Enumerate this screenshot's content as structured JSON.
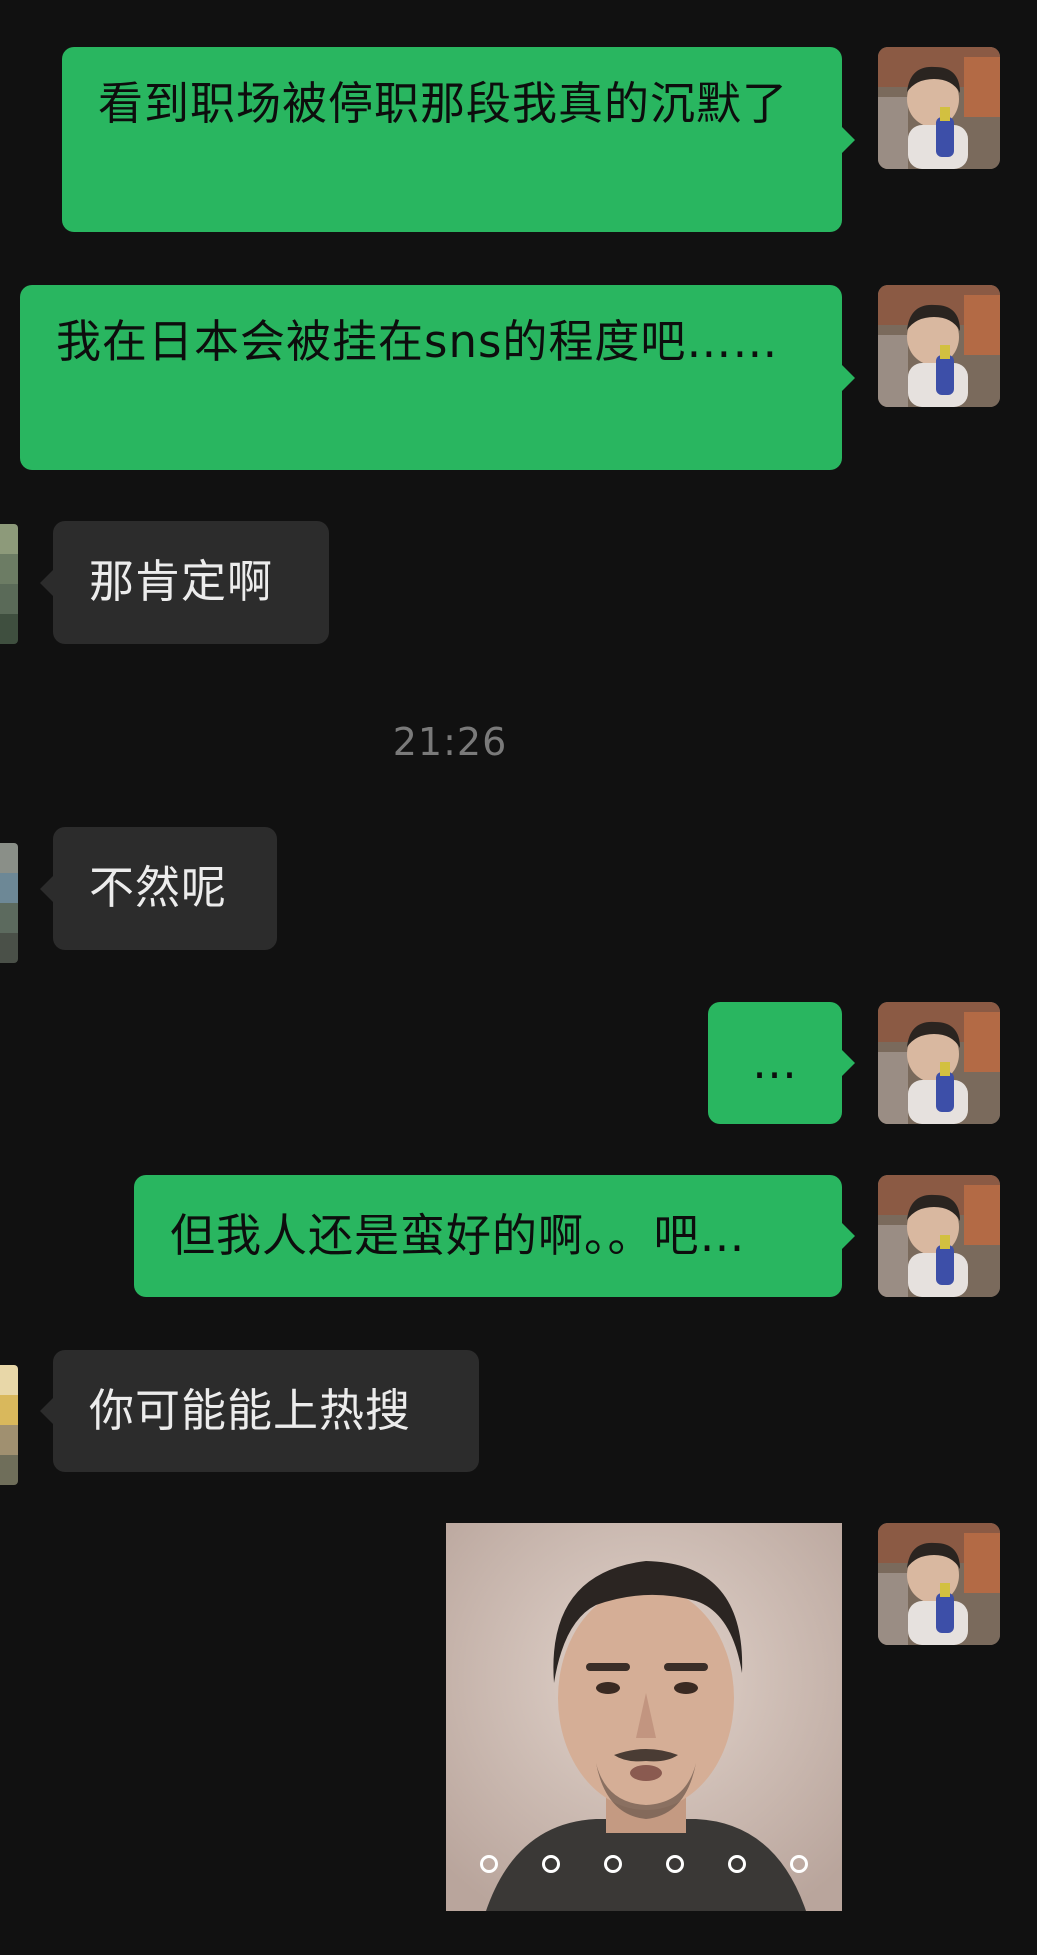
{
  "messages": [
    {
      "text": "看到职场被停职那段我真的沉默了"
    },
    {
      "text": "我在日本会被挂在sns的程度吧……"
    },
    {
      "text": "那肯定啊"
    },
    {
      "text": "不然呢"
    },
    {
      "text": "…"
    },
    {
      "text": "但我人还是蛮好的啊。。吧…"
    },
    {
      "text": "你可能能上热搜"
    }
  ],
  "timestamp": "21:26",
  "colors": {
    "background": "#111111",
    "sent_bubble": "#29b660",
    "received_bubble": "#2c2c2c",
    "timestamp_text": "#7a7a7a"
  }
}
